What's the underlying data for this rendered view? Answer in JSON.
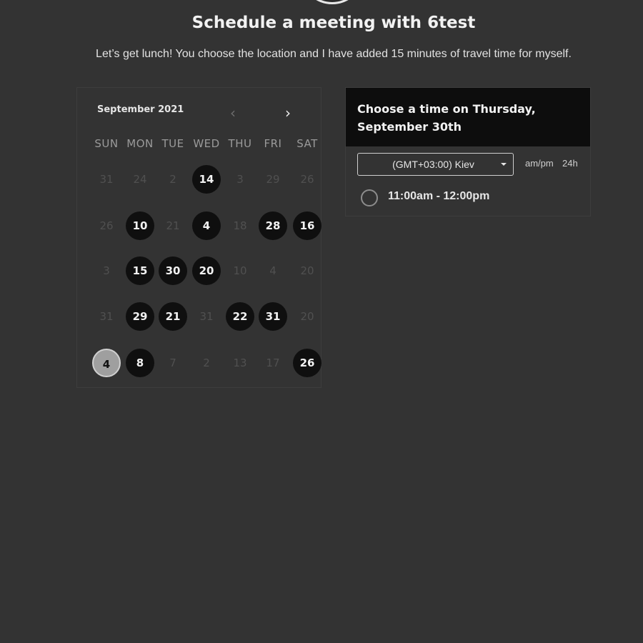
{
  "header": {
    "title": "Schedule a meeting with 6test",
    "subtitle": "Let’s get lunch! You choose the location and I have added 15 minutes of travel time for myself."
  },
  "calendar": {
    "month_label": "September 2021",
    "prev_icon": "chevron-left-icon",
    "next_icon": "chevron-right-icon",
    "weekdays": [
      "SUN",
      "MON",
      "TUE",
      "WED",
      "THU",
      "FRI",
      "SAT"
    ],
    "weeks": [
      [
        {
          "label": "31",
          "state": "off"
        },
        {
          "label": "24",
          "state": "off"
        },
        {
          "label": "2",
          "state": "off"
        },
        {
          "label": "14",
          "state": "available"
        },
        {
          "label": "3",
          "state": "off"
        },
        {
          "label": "29",
          "state": "off"
        },
        {
          "label": "26",
          "state": "off"
        }
      ],
      [
        {
          "label": "26",
          "state": "off"
        },
        {
          "label": "10",
          "state": "available"
        },
        {
          "label": "21",
          "state": "off"
        },
        {
          "label": "4",
          "state": "available"
        },
        {
          "label": "18",
          "state": "off"
        },
        {
          "label": "28",
          "state": "available"
        },
        {
          "label": "16",
          "state": "available"
        }
      ],
      [
        {
          "label": "3",
          "state": "off"
        },
        {
          "label": "15",
          "state": "available"
        },
        {
          "label": "30",
          "state": "available"
        },
        {
          "label": "20",
          "state": "available"
        },
        {
          "label": "10",
          "state": "off"
        },
        {
          "label": "4",
          "state": "off"
        },
        {
          "label": "20",
          "state": "off"
        }
      ],
      [
        {
          "label": "31",
          "state": "off"
        },
        {
          "label": "29",
          "state": "available"
        },
        {
          "label": "21",
          "state": "available"
        },
        {
          "label": "31",
          "state": "off"
        },
        {
          "label": "22",
          "state": "available"
        },
        {
          "label": "31",
          "state": "available"
        },
        {
          "label": "20",
          "state": "off"
        }
      ],
      [
        {
          "label": "4",
          "state": "selected"
        },
        {
          "label": "8",
          "state": "available"
        },
        {
          "label": "7",
          "state": "off"
        },
        {
          "label": "2",
          "state": "off"
        },
        {
          "label": "13",
          "state": "off"
        },
        {
          "label": "17",
          "state": "off"
        },
        {
          "label": "26",
          "state": "available"
        }
      ]
    ]
  },
  "time_panel": {
    "heading": "Choose a time on Thursday, September 30th",
    "timezone": "(GMT+03:00) Kiev",
    "timezone_icon": "caret-down-icon",
    "format_ampm": "am/pm",
    "format_24h": "24h",
    "slots": [
      {
        "label": "11:00am - 12:00pm",
        "selected": false
      }
    ]
  },
  "colors": {
    "background": "#333333",
    "available_day": "#0f0f0f",
    "selected_day": "#9f9f9f",
    "panel_header": "#0d0d0d"
  }
}
